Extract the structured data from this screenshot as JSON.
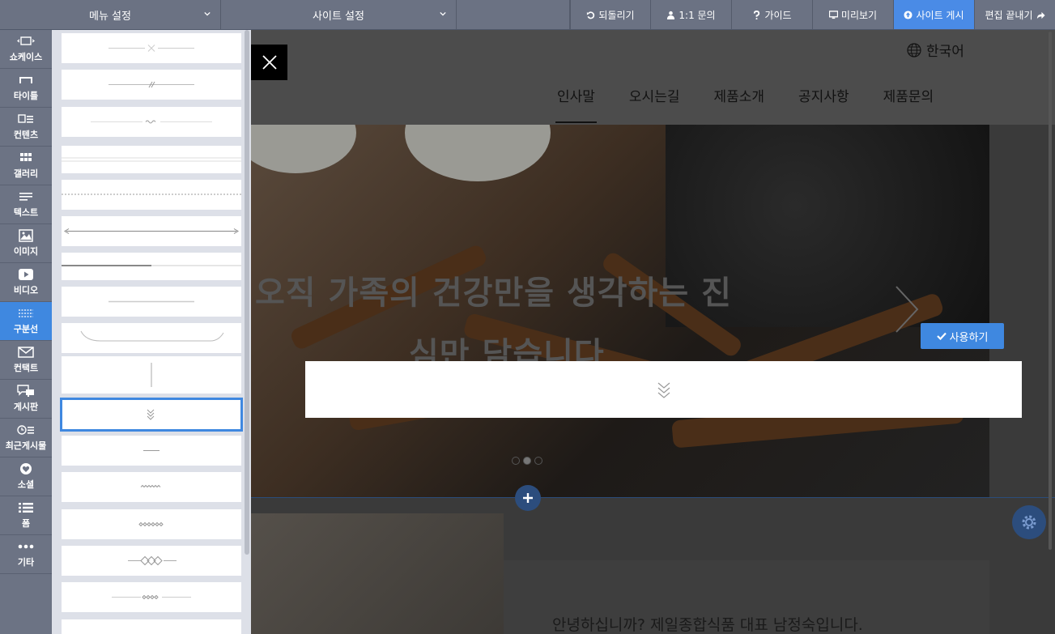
{
  "topbar": {
    "menu_settings": "메뉴 설정",
    "site_settings": "사이트 설정",
    "undo": "되돌리기",
    "inquiry": "1:1 문의",
    "guide": "가이드",
    "preview": "미리보기",
    "publish": "사이트 게시",
    "finish_edit": "편집 끝내기"
  },
  "rail": {
    "items": [
      {
        "label": "쇼케이스",
        "icon": "showcase-icon"
      },
      {
        "label": "타이틀",
        "icon": "title-icon"
      },
      {
        "label": "컨텐츠",
        "icon": "content-icon"
      },
      {
        "label": "갤러리",
        "icon": "gallery-icon"
      },
      {
        "label": "텍스트",
        "icon": "text-icon"
      },
      {
        "label": "이미지",
        "icon": "image-icon"
      },
      {
        "label": "비디오",
        "icon": "video-icon"
      },
      {
        "label": "구분선",
        "icon": "divider-icon"
      },
      {
        "label": "컨택트",
        "icon": "contact-icon"
      },
      {
        "label": "게시판",
        "icon": "board-icon"
      },
      {
        "label": "최근게시물",
        "icon": "recent-posts-icon"
      },
      {
        "label": "소셜",
        "icon": "social-icon"
      },
      {
        "label": "폼",
        "icon": "form-icon"
      },
      {
        "label": "기타",
        "icon": "more-icon"
      }
    ],
    "active_index": 7
  },
  "site": {
    "language": "한국어",
    "nav": [
      "인사말",
      "오시는길",
      "제품소개",
      "공지사항",
      "제품문의"
    ],
    "hero_text_line1": "오직 가족의 건강만을 생각하는 진",
    "hero_text_line2": "심만 담습니다",
    "intro_text": "안녕하십니까? 제일종합식품 대표 남정숙입니다.",
    "use_button": "사용하기"
  },
  "colors": {
    "toolbar_bg": "#6b7283",
    "accent": "#3f88e0",
    "dark_blue": "#2c4d7d"
  }
}
